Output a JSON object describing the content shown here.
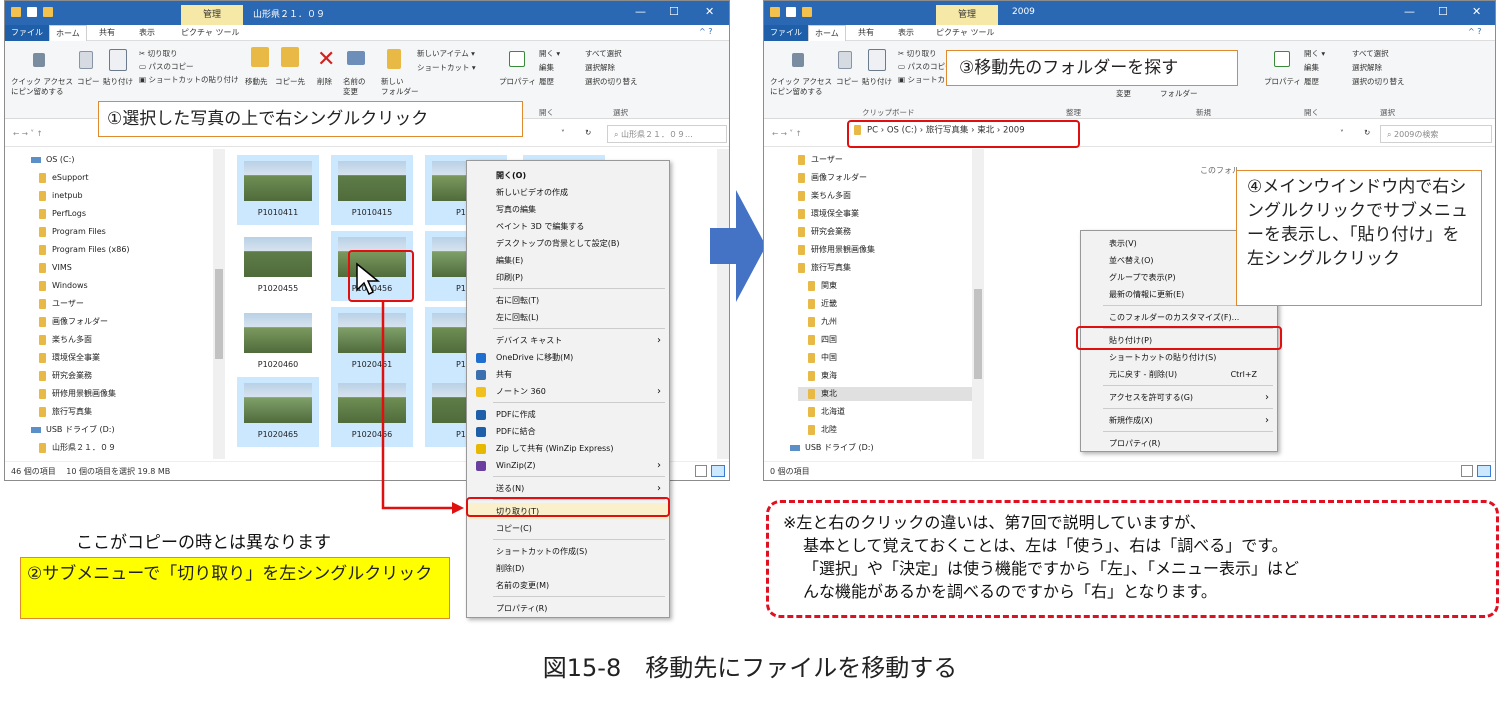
{
  "left": {
    "manage_tab": "管理",
    "title": "山形県２１．０９",
    "ribbon_tabs": [
      "ファイル",
      "ホーム",
      "共有",
      "表示",
      "ピクチャ ツール"
    ],
    "ribbon": {
      "pin": "クイック アクセス\nにピン留めする",
      "copy": "コピー",
      "paste": "貼り付け",
      "cut": "切り取り",
      "copy_path": "パスのコピー",
      "paste_shortcut": "ショートカットの貼り付け",
      "move_to": "移動先",
      "copy_to": "コピー先",
      "delete": "削除",
      "rename": "名前の\n変更",
      "new_folder": "新しい\nフォルダー",
      "new_item": "新しいアイテム ▾",
      "shortcut": "ショートカット ▾",
      "properties": "プロパティ",
      "open": "開く ▾",
      "edit": "編集",
      "history": "履歴",
      "select_all": "すべて選択",
      "select_none": "選択解除",
      "invert": "選択の切り替え",
      "group_open": "開く",
      "group_select": "選択"
    },
    "search": "山形県２１．０９...",
    "nav": [
      "OS (C:)",
      "eSupport",
      "inetpub",
      "PerfLogs",
      "Program Files",
      "Program Files (x86)",
      "VIMS",
      "Windows",
      "ユーザー",
      "画像フォルダー",
      "楽ちん多面",
      "環境保全事業",
      "研究会業務",
      "研修用景観画像集",
      "旅行写真集",
      "USB ドライブ (D:)",
      "山形県２１．０９"
    ],
    "tiles": [
      "P1010411",
      "P1010415",
      "P101",
      "4",
      "P1020455",
      "P1020456",
      "P102",
      "9",
      "P1020460",
      "P1020461",
      "P102",
      "4",
      "P1020465",
      "P1020466",
      "P102",
      "9"
    ],
    "status": "46 個の項目　 10 個の項目を選択  19.8 MB",
    "menu": [
      "開く(O)",
      "新しいビデオの作成",
      "写真の編集",
      "ペイント 3D で編集する",
      "デスクトップの背景として設定(B)",
      "編集(E)",
      "印刷(P)",
      "右に回転(T)",
      "左に回転(L)",
      "デバイス キャスト",
      "OneDrive に移動(M)",
      "共有",
      "ノートン 360",
      "PDFに作成",
      "PDFに結合",
      "Zip して共有 (WinZip Express)",
      "WinZip(Z)",
      "送る(N)",
      "切り取り(T)",
      "コピー(C)",
      "ショートカットの作成(S)",
      "削除(D)",
      "名前の変更(M)",
      "プロパティ(R)"
    ],
    "callout1": "①選択した写真の上で右シングルクリック",
    "note_text": "ここがコピーの時とは異なります",
    "callout2": "②サブメニューで「切り取り」を左シングルクリック"
  },
  "right": {
    "manage_tab": "管理",
    "title": "2009",
    "ribbon_tabs": [
      "ファイル",
      "ホーム",
      "共有",
      "表示",
      "ピクチャ ツール"
    ],
    "ribbon": {
      "pin": "クイック アクセス\nにピン留めする",
      "copy": "コピー",
      "paste": "貼り付け",
      "cut": "切り取り",
      "copy_path": "パスのコピー",
      "paste_shortcut": "ショートカットの貼り付け",
      "clipboard": "クリップボード",
      "change": "変更",
      "folder": "フォルダー",
      "organize": "整理",
      "new": "新規",
      "properties": "プロパティ",
      "open": "開く ▾",
      "edit": "編集",
      "history": "履歴",
      "select_all": "すべて選択",
      "select_none": "選択解除",
      "invert": "選択の切り替え",
      "group_open": "開く",
      "group_select": "選択"
    },
    "path": "PC  ›  OS (C:)  ›  旅行写真集  ›  東北  ›  2009",
    "search": "2009の検索",
    "nav": [
      "ユーザー",
      "画像フォルダー",
      "楽ちん多面",
      "環境保全事業",
      "研究会業務",
      "研修用景観画像集",
      "旅行写真集",
      "関東",
      "近畿",
      "九州",
      "四国",
      "中国",
      "東海",
      "東北",
      "北海道",
      "北陸",
      "USB ドライブ (D:)"
    ],
    "empty_text": "このフォル",
    "status": "0 個の項目",
    "menu": [
      "表示(V)",
      "並べ替え(O)",
      "グループで表示(P)",
      "最新の情報に更新(E)",
      "このフォルダーのカスタマイズ(F)...",
      "貼り付け(P)",
      "ショートカットの貼り付け(S)",
      "元に戻す - 削除(U)",
      "アクセスを許可する(G)",
      "新規作成(X)",
      "プロパティ(R)"
    ],
    "undo_shortcut": "Ctrl+Z",
    "callout3": "③移動先のフォルダーを探す",
    "callout4": "④メインウインドウ内で右シングルクリックでサブメニューを表示し、「貼り付け」を左シングルクリック"
  },
  "note": {
    "line1": "※左と右のクリックの違いは、第7回で説明していますが、",
    "line2": "基本として覚えておくことは、左は「使う」、右は「調べる」です。",
    "line3": "「選択」や「決定」は使う機能ですから「左」、「メニュー表示」はど",
    "line4": "んな機能があるかを調べるのですから「右」となります。"
  },
  "caption": "図15-8　移動先にファイルを移動する",
  "colors": {
    "title_bar": "#2b68b3",
    "selection": "#cce8ff",
    "callout_border": "#e08a30",
    "highlight_red": "#e01010",
    "callout_yellow": "#ffff00",
    "arrow_blue": "#4472c4"
  }
}
